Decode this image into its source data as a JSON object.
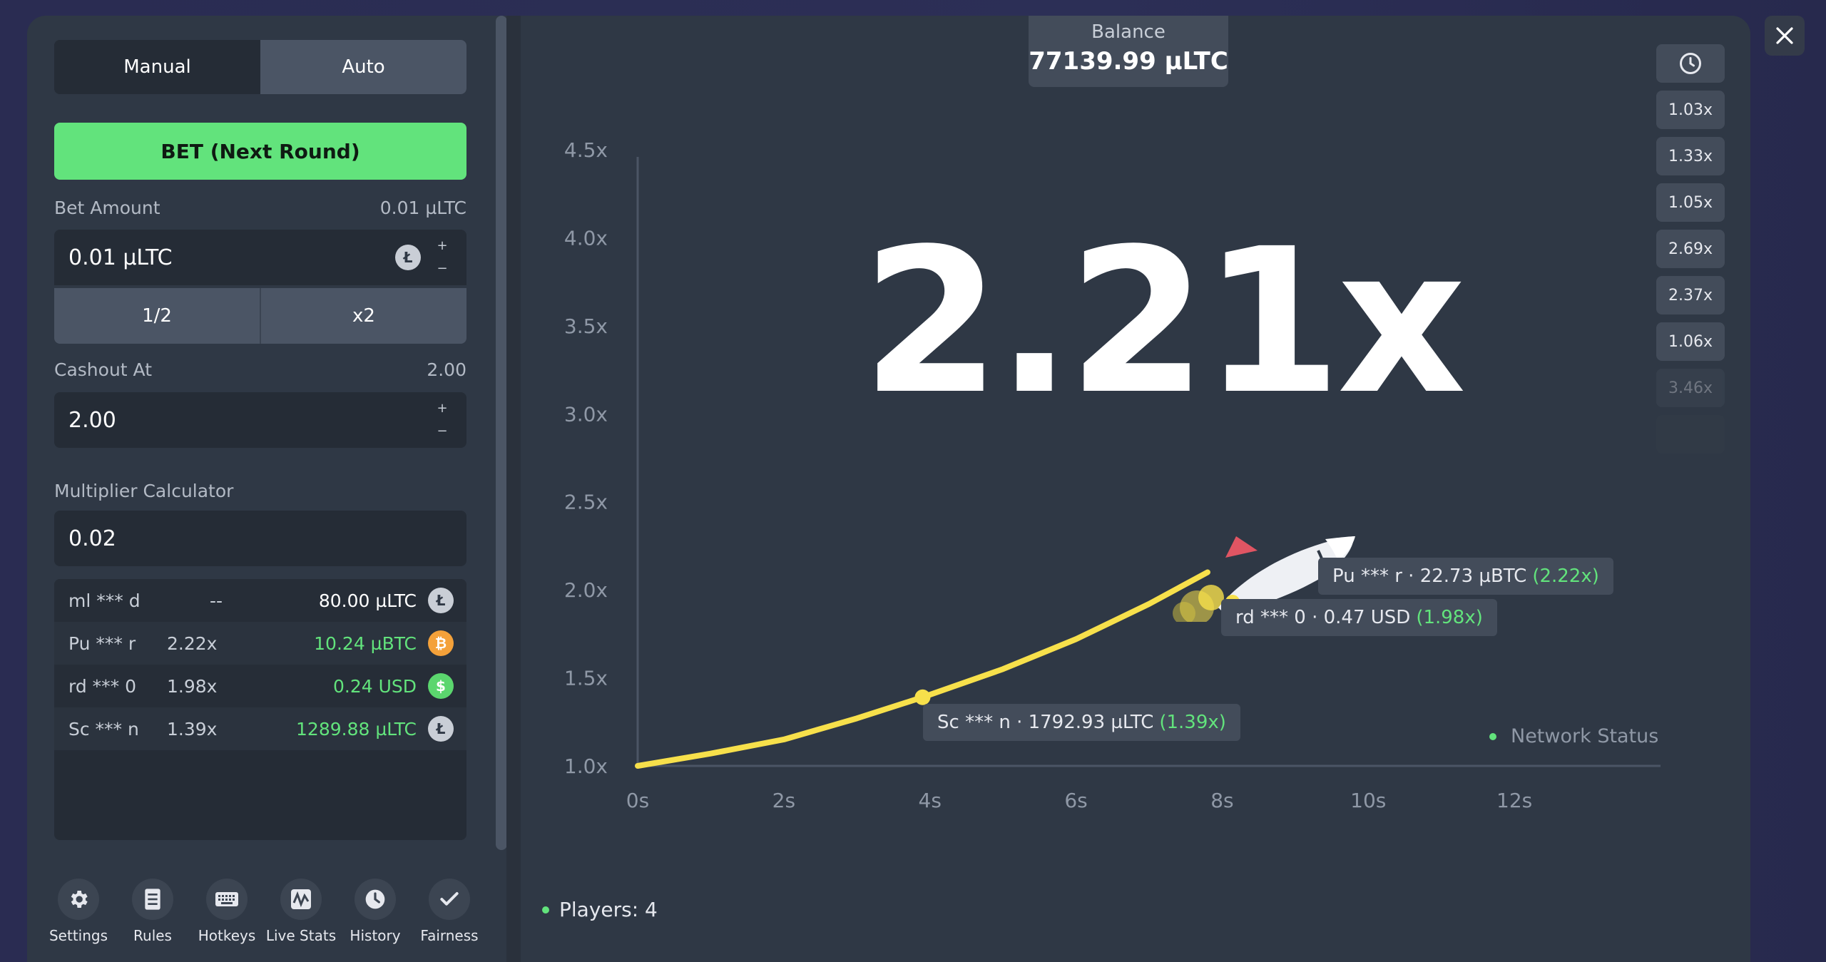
{
  "controls": {
    "tabs": [
      {
        "label": "Manual"
      },
      {
        "label": "Auto"
      }
    ],
    "bet_button": "BET (Next Round)",
    "bet_amount_label": "Bet Amount",
    "bet_amount_right": "0.01 µLTC",
    "bet_amount_value": "0.01 µLTC",
    "half_label": "1/2",
    "double_label": "x2",
    "cashout_label": "Cashout At",
    "cashout_right": "2.00",
    "cashout_value": "2.00",
    "calc_label": "Multiplier Calculator",
    "calc_value": "0.02",
    "stepper_plus": "+",
    "stepper_minus": "−"
  },
  "bet_list": [
    {
      "name": "ml *** d",
      "mult": "--",
      "amount": "80.00 µLTC",
      "coin": "L",
      "coin_color": "#c9ced6",
      "amount_color": "white"
    },
    {
      "name": "Pu *** r",
      "mult": "2.22x",
      "amount": "10.24 µBTC",
      "coin": "₿",
      "coin_color": "#f4a13a",
      "amount_color": "green"
    },
    {
      "name": "rd *** 0",
      "mult": "1.98x",
      "amount": "0.24 USD",
      "coin": "$",
      "coin_color": "#5bd66e",
      "amount_color": "green"
    },
    {
      "name": "Sc *** n",
      "mult": "1.39x",
      "amount": "1289.88 µLTC",
      "coin": "L",
      "coin_color": "#c9ced6",
      "amount_color": "green"
    }
  ],
  "bottom_nav": [
    {
      "label": "Settings",
      "icon": "gear-icon"
    },
    {
      "label": "Rules",
      "icon": "document-icon"
    },
    {
      "label": "Hotkeys",
      "icon": "keyboard-icon"
    },
    {
      "label": "Live Stats",
      "icon": "stats-icon"
    },
    {
      "label": "History",
      "icon": "clock-icon"
    },
    {
      "label": "Fairness",
      "icon": "checkmark-icon"
    }
  ],
  "balance": {
    "label": "Balance",
    "value": "77139.99 µLTC"
  },
  "recent_multipliers": [
    "1.03x",
    "1.33x",
    "1.05x",
    "2.69x",
    "2.37x",
    "1.06x",
    "3.46x"
  ],
  "current_multiplier": "2.21x",
  "tooltips": [
    {
      "text": "Pu *** r · 22.73 µBTC",
      "mult": "(2.22x)"
    },
    {
      "text": "rd *** 0 · 0.47 USD",
      "mult": "(1.98x)"
    },
    {
      "text": "Sc *** n · 1792.93 µLTC",
      "mult": "(1.39x)"
    }
  ],
  "network_status": "Network Status",
  "players_count": "Players: 4",
  "colors": {
    "accent_green": "#62e37c",
    "curve_yellow": "#f7e04b",
    "panel": "#2f3845"
  },
  "chart_data": {
    "type": "line",
    "x_ticks": [
      "0s",
      "2s",
      "4s",
      "6s",
      "8s",
      "10s",
      "12s"
    ],
    "y_ticks": [
      "1.0x",
      "1.5x",
      "2.0x",
      "2.5x",
      "3.0x",
      "3.5x",
      "4.0x",
      "4.5x"
    ],
    "xlim": [
      0,
      14
    ],
    "ylim": [
      1.0,
      4.5
    ],
    "series": [
      {
        "x": [
          0,
          1,
          2,
          3,
          3.9,
          5,
          6,
          7,
          7.8
        ],
        "y": [
          1.0,
          1.07,
          1.15,
          1.27,
          1.39,
          1.55,
          1.72,
          1.92,
          2.1
        ]
      }
    ],
    "markers": [
      {
        "x": 3.9,
        "y": 1.39
      }
    ]
  }
}
